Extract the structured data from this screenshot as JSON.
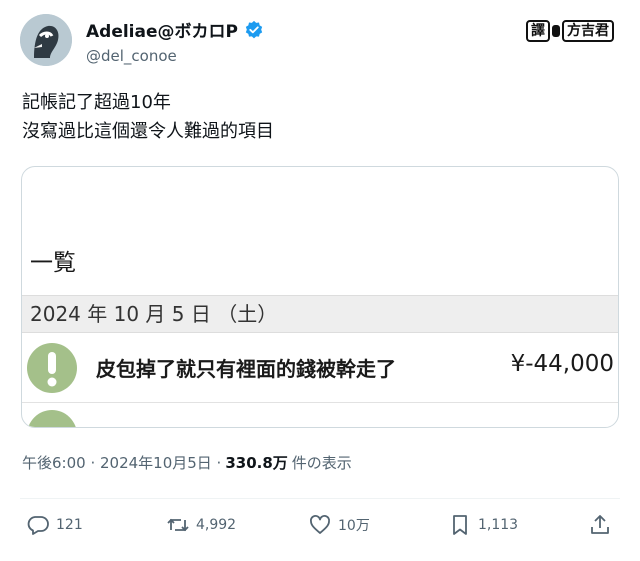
{
  "author": {
    "display_name": "Adeliae@ボカロP",
    "handle": "@del_conoe"
  },
  "watermark": {
    "text": "譯",
    "text2": "方吉君"
  },
  "tweet": {
    "line1": "記帳記了超過10年",
    "line2": "沒寫過比這個還令人難過的項目"
  },
  "card": {
    "title": "一覧",
    "date": "2024 年 10 月 5 日 （土）",
    "entry_label": "皮包掉了就只有裡面的錢被幹走了",
    "entry_amount": "¥-44,000"
  },
  "meta": {
    "time": "午後6:00 · 2024年10月5日 ·",
    "views": "330.8万",
    "views_suffix": "件の表示"
  },
  "actions": {
    "replies": "121",
    "retweets": "4,992",
    "likes": "10万",
    "bookmarks": "1,113"
  },
  "colors": {
    "verified": "#1d9bf0",
    "icon_green": "#a4c08a",
    "secondary_text": "#536471"
  }
}
